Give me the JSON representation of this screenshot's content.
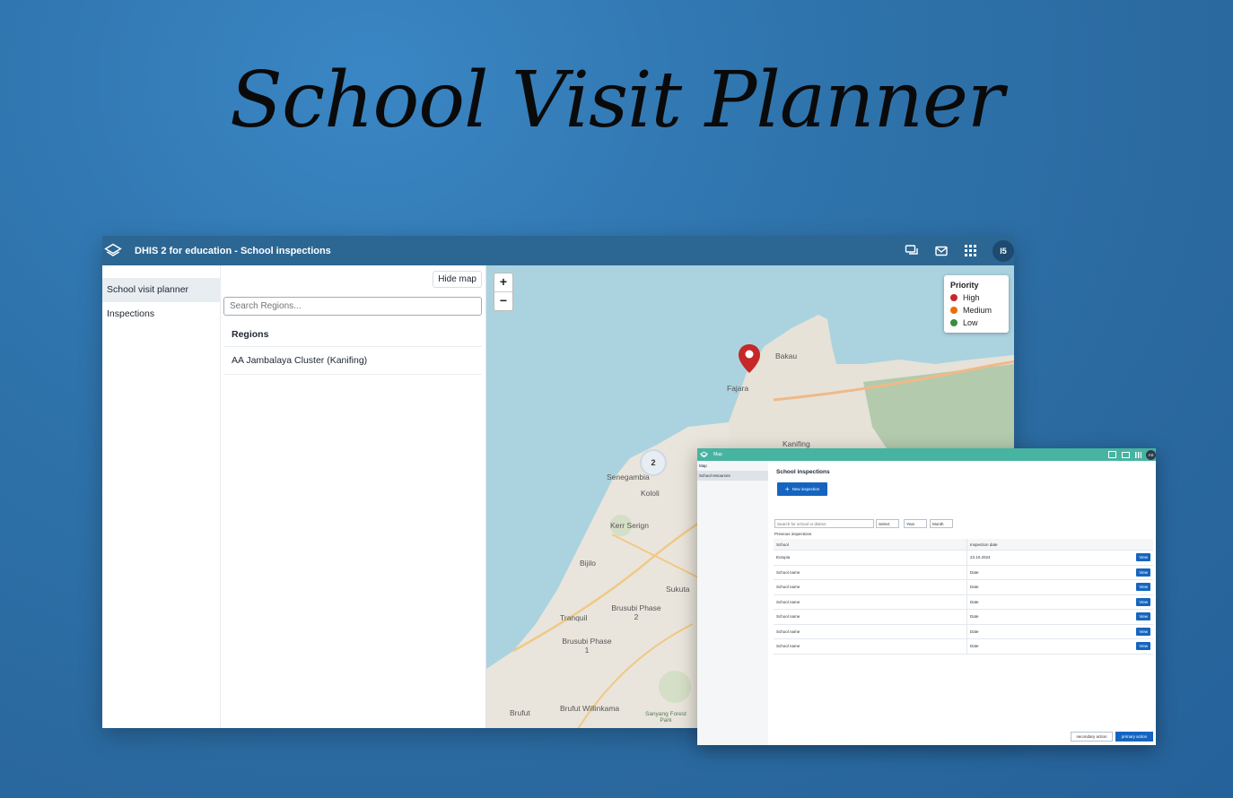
{
  "hero": {
    "title": "School Visit Planner"
  },
  "main_window": {
    "app_title": "DHIS 2 for education - School inspections",
    "avatar_initials": "I5",
    "sidebar": {
      "items": [
        {
          "label": "School visit planner",
          "active": true
        },
        {
          "label": "Inspections",
          "active": false
        }
      ]
    },
    "panel": {
      "hide_map_label": "Hide map",
      "search_placeholder": "Search Regions...",
      "regions_header": "Regions",
      "regions": [
        "AA Jambalaya Cluster (Kanifing)"
      ]
    },
    "map": {
      "zoom_in": "+",
      "zoom_out": "−",
      "cluster_count": "2",
      "legend": {
        "title": "Priority",
        "items": [
          {
            "label": "High",
            "color": "#c62828"
          },
          {
            "label": "Medium",
            "color": "#ef6c00"
          },
          {
            "label": "Low",
            "color": "#388e3c"
          }
        ]
      },
      "place_labels": [
        "Bakau",
        "Fajara",
        "Kanifing",
        "Senegambia",
        "Kololi",
        "Kerr Serign",
        "Bijilo",
        "Sukuta",
        "Brusubi Phase 2",
        "Tranquil",
        "Brusubi Phase 1",
        "Brufut Willinkama",
        "Brufut",
        "Sanyang Forest Park"
      ]
    }
  },
  "second_window": {
    "app_label": "Map",
    "avatar_initials": "AS",
    "sidebar": {
      "items": [
        "Map",
        "School resources"
      ]
    },
    "page_title": "School inspections",
    "new_button": "New inspection",
    "search_placeholder": "Search for school or district",
    "filters": [
      "Select",
      "Year",
      "Month"
    ],
    "section_label": "Previous inspections",
    "columns": [
      "School",
      "Inspection date"
    ],
    "rows": [
      {
        "school": "Eutopia",
        "date": "23.10.2024"
      },
      {
        "school": "School name",
        "date": "Date"
      },
      {
        "school": "School name",
        "date": "Date"
      },
      {
        "school": "School name",
        "date": "Date"
      },
      {
        "school": "School name",
        "date": "Date"
      },
      {
        "school": "School name",
        "date": "Date"
      },
      {
        "school": "School name",
        "date": "Date"
      }
    ],
    "view_label": "View",
    "secondary_action": "secondary action",
    "primary_action": "primary action"
  }
}
